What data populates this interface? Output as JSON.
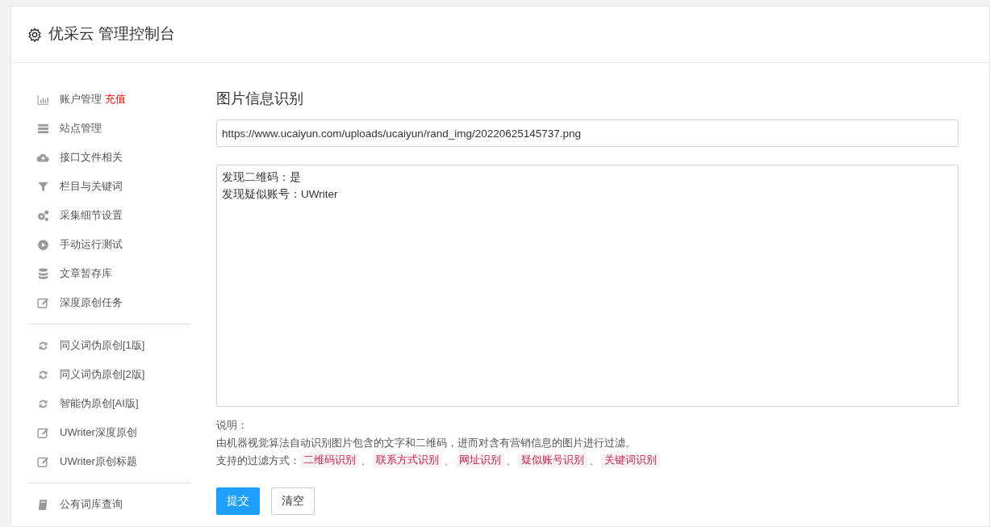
{
  "header": {
    "title": "优采云 管理控制台"
  },
  "sidebar": {
    "groups": [
      {
        "items": [
          {
            "kind": "chart",
            "label": "账户管理",
            "badge": "充值"
          },
          {
            "kind": "server",
            "label": "站点管理"
          },
          {
            "kind": "cloud",
            "label": "接口文件相关"
          },
          {
            "kind": "filter",
            "label": "栏目与关键词"
          },
          {
            "kind": "gears",
            "label": "采集细节设置"
          },
          {
            "kind": "play",
            "label": "手动运行测试"
          },
          {
            "kind": "database",
            "label": "文章暂存库"
          },
          {
            "kind": "edit",
            "label": "深度原创任务"
          }
        ]
      },
      {
        "items": [
          {
            "kind": "refresh",
            "label": "同义词伪原创[1版]"
          },
          {
            "kind": "refresh",
            "label": "同义词伪原创[2版]"
          },
          {
            "kind": "refresh",
            "label": "智能伪原创[AI版]"
          },
          {
            "kind": "edit",
            "label": "UWriter深度原创"
          },
          {
            "kind": "edit",
            "label": "UWriter原创标题"
          }
        ]
      },
      {
        "items": [
          {
            "kind": "book",
            "label": "公有词库查询"
          }
        ]
      }
    ]
  },
  "main": {
    "title": "图片信息识别",
    "url_field": {
      "value": "https://www.ucaiyun.com/uploads/ucaiyun/rand_img/20220625145737.png"
    },
    "result_box": {
      "lines": [
        "发现二维码：是",
        "发现疑似账号：UWriter"
      ]
    },
    "notes": {
      "heading": "说明：",
      "description": "由机器视觉算法自动识别图片包含的文字和二维码，进而对含有营销信息的图片进行过滤。",
      "methods_label": "支持的过滤方式：",
      "methods": [
        "二维码识别",
        "联系方式识别",
        "网址识别",
        "疑似账号识别",
        "关键词识别"
      ],
      "separator": "、"
    },
    "buttons": [
      {
        "kind": "primary",
        "label": "提交"
      },
      {
        "kind": "default",
        "label": "清空"
      }
    ]
  }
}
